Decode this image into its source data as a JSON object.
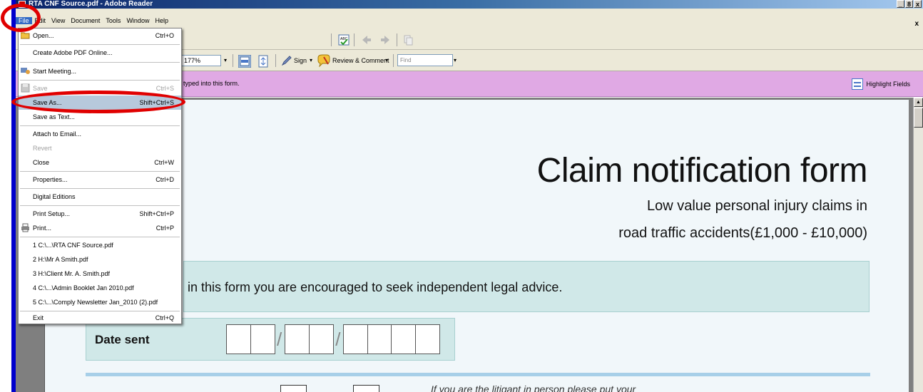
{
  "window": {
    "title": "RTA CNF Source.pdf - Adobe Reader",
    "buttons": [
      "_",
      "8",
      "x"
    ],
    "doc_close": "x"
  },
  "menubar": {
    "items": [
      "File",
      "Edit",
      "View",
      "Document",
      "Tools",
      "Window",
      "Help"
    ]
  },
  "toolbar": {
    "zoom": "177%",
    "sign_label": "Sign",
    "review_label": "Review & Comment",
    "find_placeholder": "Find"
  },
  "formbar": {
    "message": "typed into this form.",
    "highlight_label": "Highlight Fields"
  },
  "file_menu": {
    "items": [
      {
        "label": "Open...",
        "shortcut": "Ctrl+O",
        "icon": "folder-open-icon"
      },
      {
        "label": "Create Adobe PDF Online...",
        "shortcut": ""
      },
      {
        "label": "Start Meeting...",
        "shortcut": "",
        "icon": "meeting-icon"
      },
      {
        "label": "Save",
        "shortcut": "Ctrl+S",
        "disabled": true,
        "icon": "save-icon"
      },
      {
        "label": "Save As...",
        "shortcut": "Shift+Ctrl+S"
      },
      {
        "label": "Save as Text...",
        "shortcut": ""
      },
      {
        "label": "Attach to Email...",
        "shortcut": ""
      },
      {
        "label": "Revert",
        "shortcut": "",
        "disabled": true
      },
      {
        "label": "Close",
        "shortcut": "Ctrl+W"
      },
      {
        "label": "Properties...",
        "shortcut": "Ctrl+D"
      },
      {
        "label": "Digital Editions",
        "shortcut": ""
      },
      {
        "label": "Print Setup...",
        "shortcut": "Shift+Ctrl+P"
      },
      {
        "label": "Print...",
        "shortcut": "Ctrl+P",
        "icon": "printer-icon"
      },
      {
        "label": "1 C:\\...\\RTA CNF Source.pdf",
        "shortcut": ""
      },
      {
        "label": "2 H:\\Mr A Smith.pdf",
        "shortcut": ""
      },
      {
        "label": "3 H:\\Client Mr. A. Smith.pdf",
        "shortcut": ""
      },
      {
        "label": "4 C:\\...\\Admin Booklet Jan 2010.pdf",
        "shortcut": ""
      },
      {
        "label": "5 C:\\...\\Comply Newsletter Jan_2010 (2).pdf",
        "shortcut": ""
      },
      {
        "label": "Exit",
        "shortcut": "Ctrl+Q"
      }
    ]
  },
  "document": {
    "title": "Claim notification form",
    "subtitle1": "Low value personal injury claims in",
    "subtitle2": "road traffic accidents(£1,000 - £10,000)",
    "advice": "in this form you are encouraged to seek independent legal advice.",
    "date_label": "Date sent",
    "date_slash": "/",
    "note": "If you are the litigant in person please put your"
  },
  "colors": {
    "annotation": "#e00000",
    "formbar": "#e0a9e4",
    "form_panel": "#d0e8e8"
  }
}
